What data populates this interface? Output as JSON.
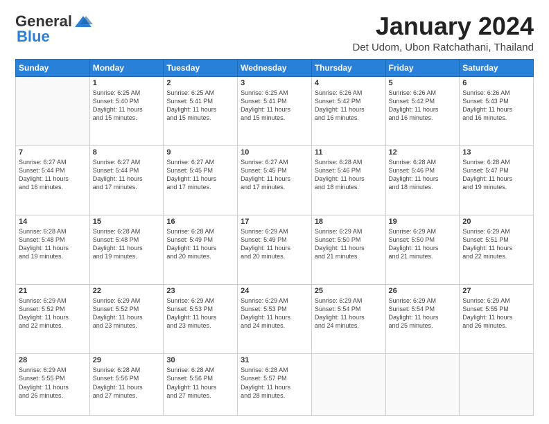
{
  "header": {
    "logo_general": "General",
    "logo_blue": "Blue",
    "month_title": "January 2024",
    "location": "Det Udom, Ubon Ratchathani, Thailand"
  },
  "days_of_week": [
    "Sunday",
    "Monday",
    "Tuesday",
    "Wednesday",
    "Thursday",
    "Friday",
    "Saturday"
  ],
  "weeks": [
    [
      {
        "day": "",
        "content": ""
      },
      {
        "day": "1",
        "content": "Sunrise: 6:25 AM\nSunset: 5:40 PM\nDaylight: 11 hours\nand 15 minutes."
      },
      {
        "day": "2",
        "content": "Sunrise: 6:25 AM\nSunset: 5:41 PM\nDaylight: 11 hours\nand 15 minutes."
      },
      {
        "day": "3",
        "content": "Sunrise: 6:25 AM\nSunset: 5:41 PM\nDaylight: 11 hours\nand 15 minutes."
      },
      {
        "day": "4",
        "content": "Sunrise: 6:26 AM\nSunset: 5:42 PM\nDaylight: 11 hours\nand 16 minutes."
      },
      {
        "day": "5",
        "content": "Sunrise: 6:26 AM\nSunset: 5:42 PM\nDaylight: 11 hours\nand 16 minutes."
      },
      {
        "day": "6",
        "content": "Sunrise: 6:26 AM\nSunset: 5:43 PM\nDaylight: 11 hours\nand 16 minutes."
      }
    ],
    [
      {
        "day": "7",
        "content": "Sunrise: 6:27 AM\nSunset: 5:44 PM\nDaylight: 11 hours\nand 16 minutes."
      },
      {
        "day": "8",
        "content": "Sunrise: 6:27 AM\nSunset: 5:44 PM\nDaylight: 11 hours\nand 17 minutes."
      },
      {
        "day": "9",
        "content": "Sunrise: 6:27 AM\nSunset: 5:45 PM\nDaylight: 11 hours\nand 17 minutes."
      },
      {
        "day": "10",
        "content": "Sunrise: 6:27 AM\nSunset: 5:45 PM\nDaylight: 11 hours\nand 17 minutes."
      },
      {
        "day": "11",
        "content": "Sunrise: 6:28 AM\nSunset: 5:46 PM\nDaylight: 11 hours\nand 18 minutes."
      },
      {
        "day": "12",
        "content": "Sunrise: 6:28 AM\nSunset: 5:46 PM\nDaylight: 11 hours\nand 18 minutes."
      },
      {
        "day": "13",
        "content": "Sunrise: 6:28 AM\nSunset: 5:47 PM\nDaylight: 11 hours\nand 19 minutes."
      }
    ],
    [
      {
        "day": "14",
        "content": "Sunrise: 6:28 AM\nSunset: 5:48 PM\nDaylight: 11 hours\nand 19 minutes."
      },
      {
        "day": "15",
        "content": "Sunrise: 6:28 AM\nSunset: 5:48 PM\nDaylight: 11 hours\nand 19 minutes."
      },
      {
        "day": "16",
        "content": "Sunrise: 6:28 AM\nSunset: 5:49 PM\nDaylight: 11 hours\nand 20 minutes."
      },
      {
        "day": "17",
        "content": "Sunrise: 6:29 AM\nSunset: 5:49 PM\nDaylight: 11 hours\nand 20 minutes."
      },
      {
        "day": "18",
        "content": "Sunrise: 6:29 AM\nSunset: 5:50 PM\nDaylight: 11 hours\nand 21 minutes."
      },
      {
        "day": "19",
        "content": "Sunrise: 6:29 AM\nSunset: 5:50 PM\nDaylight: 11 hours\nand 21 minutes."
      },
      {
        "day": "20",
        "content": "Sunrise: 6:29 AM\nSunset: 5:51 PM\nDaylight: 11 hours\nand 22 minutes."
      }
    ],
    [
      {
        "day": "21",
        "content": "Sunrise: 6:29 AM\nSunset: 5:52 PM\nDaylight: 11 hours\nand 22 minutes."
      },
      {
        "day": "22",
        "content": "Sunrise: 6:29 AM\nSunset: 5:52 PM\nDaylight: 11 hours\nand 23 minutes."
      },
      {
        "day": "23",
        "content": "Sunrise: 6:29 AM\nSunset: 5:53 PM\nDaylight: 11 hours\nand 23 minutes."
      },
      {
        "day": "24",
        "content": "Sunrise: 6:29 AM\nSunset: 5:53 PM\nDaylight: 11 hours\nand 24 minutes."
      },
      {
        "day": "25",
        "content": "Sunrise: 6:29 AM\nSunset: 5:54 PM\nDaylight: 11 hours\nand 24 minutes."
      },
      {
        "day": "26",
        "content": "Sunrise: 6:29 AM\nSunset: 5:54 PM\nDaylight: 11 hours\nand 25 minutes."
      },
      {
        "day": "27",
        "content": "Sunrise: 6:29 AM\nSunset: 5:55 PM\nDaylight: 11 hours\nand 26 minutes."
      }
    ],
    [
      {
        "day": "28",
        "content": "Sunrise: 6:29 AM\nSunset: 5:55 PM\nDaylight: 11 hours\nand 26 minutes."
      },
      {
        "day": "29",
        "content": "Sunrise: 6:28 AM\nSunset: 5:56 PM\nDaylight: 11 hours\nand 27 minutes."
      },
      {
        "day": "30",
        "content": "Sunrise: 6:28 AM\nSunset: 5:56 PM\nDaylight: 11 hours\nand 27 minutes."
      },
      {
        "day": "31",
        "content": "Sunrise: 6:28 AM\nSunset: 5:57 PM\nDaylight: 11 hours\nand 28 minutes."
      },
      {
        "day": "",
        "content": ""
      },
      {
        "day": "",
        "content": ""
      },
      {
        "day": "",
        "content": ""
      }
    ]
  ]
}
